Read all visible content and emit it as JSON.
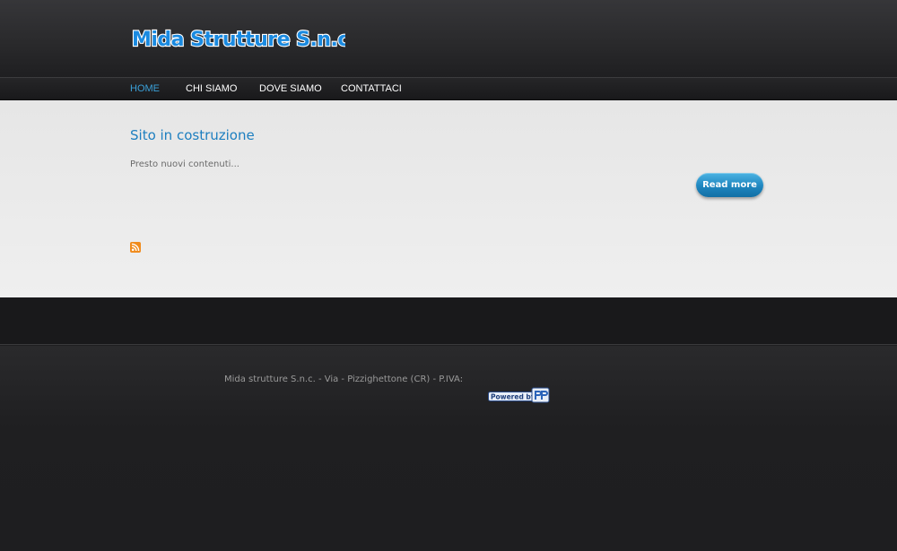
{
  "site": {
    "logo_text": "Mida Strutture S.n.c."
  },
  "nav": {
    "items": [
      {
        "label": "HOME",
        "active": true
      },
      {
        "label": "CHI SIAMO",
        "active": false
      },
      {
        "label": "DOVE SIAMO",
        "active": false
      },
      {
        "label": "CONTATTACI",
        "active": false
      }
    ]
  },
  "article": {
    "title": "Sito in costruzione",
    "body": "Presto nuovi contenuti...",
    "read_more_label": "Read more"
  },
  "footer": {
    "text": "Mida strutture S.n.c. - Via - Pizzighettone (CR) - P.IVA:",
    "powered_label": "Powered by",
    "rss_icon": "rss-feed-icon"
  },
  "colors": {
    "accent": "#1d7fc0",
    "nav_active": "#3aa0d8",
    "header_bg": "#2a2a2c",
    "content_bg": "#ececec",
    "footer_bg": "#1e1e20"
  }
}
